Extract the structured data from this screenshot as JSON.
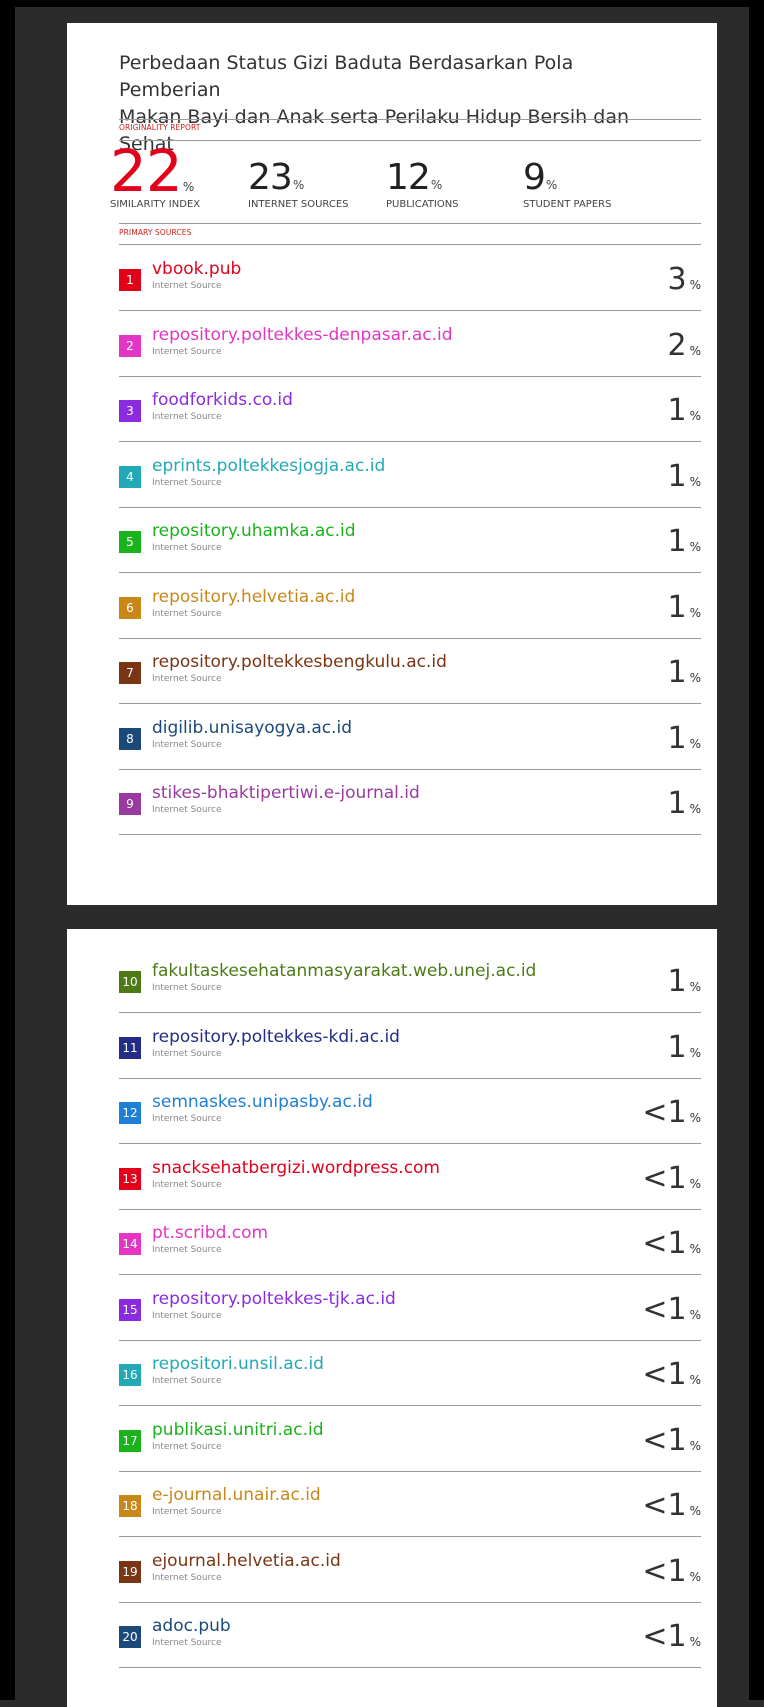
{
  "report": {
    "title_line1": "Perbedaan Status Gizi Baduta Berdasarkan Pola Pemberian",
    "title_line2": "Makan Bayi dan Anak serta Perilaku Hidup Bersih dan Sehat",
    "originality_label": "ORIGINALITY REPORT",
    "primary_label": "PRIMARY SOURCES",
    "pct_symbol": "%"
  },
  "stats": [
    {
      "value": "22",
      "label": "SIMILARITY INDEX"
    },
    {
      "value": "23",
      "label": "INTERNET SOURCES"
    },
    {
      "value": "12",
      "label": "PUBLICATIONS"
    },
    {
      "value": "9",
      "label": "STUDENT PAPERS"
    }
  ],
  "sources": [
    {
      "num": "1",
      "name": "vbook.pub",
      "type": "Internet Source",
      "pct": "3",
      "color": "#e3001b"
    },
    {
      "num": "2",
      "name": "repository.poltekkes-denpasar.ac.id",
      "type": "Internet Source",
      "pct": "2",
      "color": "#e336c5"
    },
    {
      "num": "3",
      "name": "foodforkids.co.id",
      "type": "Internet Source",
      "pct": "1",
      "color": "#8a2be2"
    },
    {
      "num": "4",
      "name": "eprints.poltekkesjogja.ac.id",
      "type": "Internet Source",
      "pct": "1",
      "color": "#22a9b5"
    },
    {
      "num": "5",
      "name": "repository.uhamka.ac.id",
      "type": "Internet Source",
      "pct": "1",
      "color": "#1bb31b"
    },
    {
      "num": "6",
      "name": "repository.helvetia.ac.id",
      "type": "Internet Source",
      "pct": "1",
      "color": "#c9871a"
    },
    {
      "num": "7",
      "name": "repository.poltekkesbengkulu.ac.id",
      "type": "Internet Source",
      "pct": "1",
      "color": "#7a3514"
    },
    {
      "num": "8",
      "name": "digilib.unisayogya.ac.id",
      "type": "Internet Source",
      "pct": "1",
      "color": "#1b4a7a"
    },
    {
      "num": "9",
      "name": "stikes-bhaktipertiwi.e-journal.id",
      "type": "Internet Source",
      "pct": "1",
      "color": "#9a3aa0"
    },
    {
      "num": "10",
      "name": "fakultaskesehatanmasyarakat.web.unej.ac.id",
      "type": "Internet Source",
      "pct": "1",
      "color": "#4e7a16"
    },
    {
      "num": "11",
      "name": "repository.poltekkes-kdi.ac.id",
      "type": "Internet Source",
      "pct": "1",
      "color": "#232c86"
    },
    {
      "num": "12",
      "name": "semnaskes.unipasby.ac.id",
      "type": "Internet Source",
      "pct": "<1",
      "color": "#1e7fd6"
    },
    {
      "num": "13",
      "name": "snacksehatbergizi.wordpress.com",
      "type": "Internet Source",
      "pct": "<1",
      "color": "#e3001b"
    },
    {
      "num": "14",
      "name": "pt.scribd.com",
      "type": "Internet Source",
      "pct": "<1",
      "color": "#e336c5"
    },
    {
      "num": "15",
      "name": "repository.poltekkes-tjk.ac.id",
      "type": "Internet Source",
      "pct": "<1",
      "color": "#8a2be2"
    },
    {
      "num": "16",
      "name": "repositori.unsil.ac.id",
      "type": "Internet Source",
      "pct": "<1",
      "color": "#22a9b5"
    },
    {
      "num": "17",
      "name": "publikasi.unitri.ac.id",
      "type": "Internet Source",
      "pct": "<1",
      "color": "#1bb31b"
    },
    {
      "num": "18",
      "name": "e-journal.unair.ac.id",
      "type": "Internet Source",
      "pct": "<1",
      "color": "#c9871a"
    },
    {
      "num": "19",
      "name": "ejournal.helvetia.ac.id",
      "type": "Internet Source",
      "pct": "<1",
      "color": "#7a3514"
    },
    {
      "num": "20",
      "name": "adoc.pub",
      "type": "Internet Source",
      "pct": "<1",
      "color": "#1b4a7a"
    }
  ]
}
